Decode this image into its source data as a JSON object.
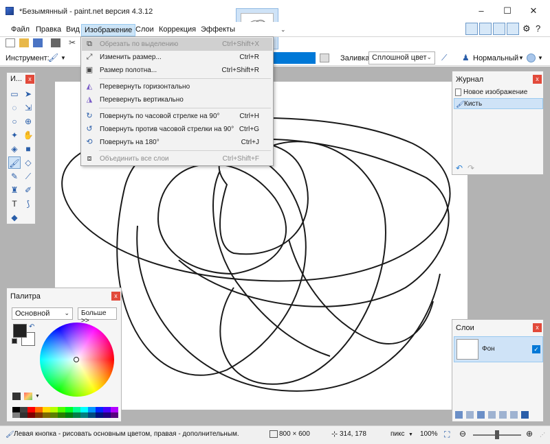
{
  "window": {
    "title": "*Безымянный - paint.net версия 4.3.12",
    "minimize": "–",
    "maximize": "☐",
    "close": "✕"
  },
  "menu": {
    "items": [
      "Файл",
      "Правка",
      "Вид",
      "Изображение",
      "Слои",
      "Коррекция",
      "Эффекты"
    ],
    "active_index": 3
  },
  "toolbar": {
    "instrument_label": "Инструмент:",
    "fill_label": "Заливка:",
    "fill_value": "Сплошной цвет",
    "blend_value": "Нормальный"
  },
  "image_menu": {
    "items": [
      {
        "label": "Обрезать по выделению",
        "shortcut": "Ctrl+Shift+X",
        "icon": "crop-icon",
        "glyph": "⧉",
        "disabled": true
      },
      {
        "label": "Изменить размер...",
        "shortcut": "Ctrl+R",
        "icon": "resize-icon",
        "glyph": "⤢",
        "disabled": false
      },
      {
        "label": "Размер полотна...",
        "shortcut": "Ctrl+Shift+R",
        "icon": "canvas-size-icon",
        "glyph": "▣",
        "disabled": false
      },
      {
        "label": "Перевернуть горизонтально",
        "shortcut": "",
        "icon": "flip-horizontal-icon",
        "glyph": "◭",
        "disabled": false
      },
      {
        "label": "Перевернуть вертикально",
        "shortcut": "",
        "icon": "flip-vertical-icon",
        "glyph": "◮",
        "disabled": false
      },
      {
        "label": "Повернуть по часовой стрелке на 90°",
        "shortcut": "Ctrl+H",
        "icon": "rotate-cw-icon",
        "glyph": "↻",
        "disabled": false
      },
      {
        "label": "Повернуть против часовой стрелки на 90°",
        "shortcut": "Ctrl+G",
        "icon": "rotate-ccw-icon",
        "glyph": "↺",
        "disabled": false
      },
      {
        "label": "Повернуть на 180°",
        "shortcut": "Ctrl+J",
        "icon": "rotate-180-icon",
        "glyph": "⟲",
        "disabled": false
      },
      {
        "label": "Объединить все слои",
        "shortcut": "Ctrl+Shift+F",
        "icon": "flatten-icon",
        "glyph": "⧈",
        "disabled": true
      }
    ]
  },
  "tools_panel": {
    "title": "И..."
  },
  "palette_panel": {
    "title": "Палитра",
    "mode": "Основной",
    "more_button": "Больше >>",
    "primary_color": "#222222",
    "secondary_color": "#ffffff"
  },
  "history_panel": {
    "title": "Журнал",
    "items": [
      "Новое изображение",
      "Кисть"
    ],
    "selected_index": 1
  },
  "layers_panel": {
    "title": "Слои",
    "layers": [
      {
        "name": "Фон",
        "visible": true
      }
    ]
  },
  "status": {
    "hint": "Левая кнопка - рисовать основным цветом, правая - дополнительным.",
    "image_size": "800 × 600",
    "cursor_pos": "314, 178",
    "units": "пикс",
    "zoom": "100%"
  },
  "colors": {
    "accent": "#0078d7",
    "selection": "#cfe3f7",
    "close_red": "#e24a3b"
  }
}
